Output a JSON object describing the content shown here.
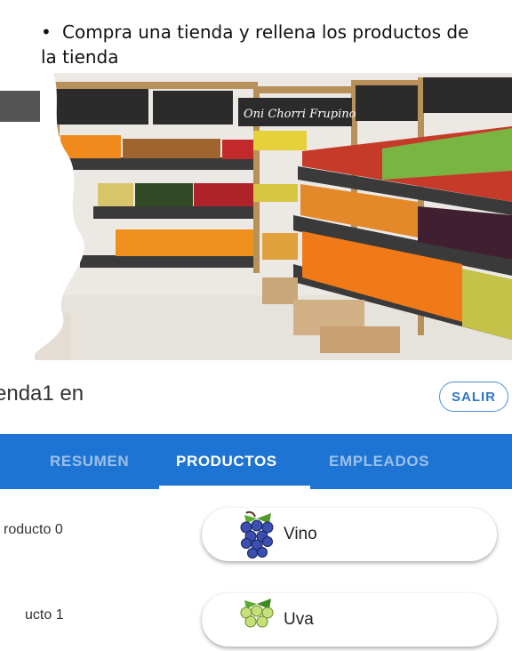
{
  "slide": {
    "bullet_symbol": "•",
    "bullet_text": "Compra una tienda y rellena los productos de",
    "bullet_text_line2": "la tienda"
  },
  "photo": {
    "signs": [
      "Oni Chorri Frupino"
    ]
  },
  "app": {
    "store_title": "enda1 en",
    "exit_label": "SALIR",
    "tabs": [
      {
        "label": "RESUMEN",
        "active": false
      },
      {
        "label": "PRODUCTOS",
        "active": true
      },
      {
        "label": "EMPLEADOS",
        "active": false
      }
    ],
    "products": [
      {
        "label": "roducto 0",
        "product": "Vino",
        "icon": "grapes-icon"
      },
      {
        "label": "ucto 1",
        "product": "Uva",
        "icon": "grapes-icon"
      }
    ],
    "colors": {
      "tab_bar": "#1e74d2",
      "accent": "#2e78c9"
    }
  }
}
